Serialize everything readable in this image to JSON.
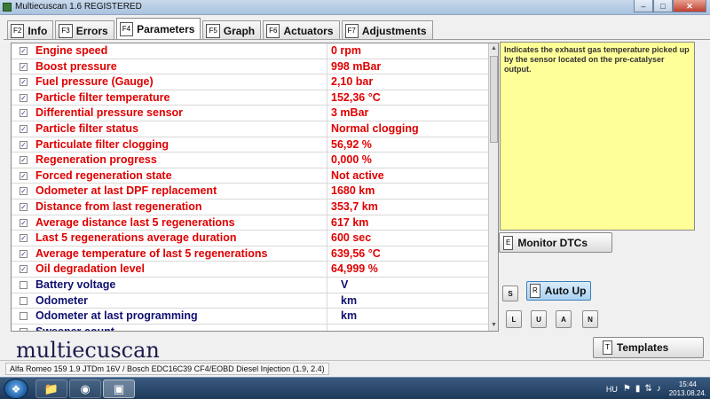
{
  "window": {
    "title": "Multiecuscan 1.6 REGISTERED"
  },
  "tabs": [
    {
      "key": "F2",
      "label": "Info"
    },
    {
      "key": "F3",
      "label": "Errors"
    },
    {
      "key": "F4",
      "label": "Parameters"
    },
    {
      "key": "F5",
      "label": "Graph"
    },
    {
      "key": "F6",
      "label": "Actuators"
    },
    {
      "key": "F7",
      "label": "Adjustments"
    }
  ],
  "active_tab": "Parameters",
  "parameters": [
    {
      "name": "Engine speed",
      "value": "0 rpm",
      "checked": true
    },
    {
      "name": "Boost pressure",
      "value": "998 mBar",
      "checked": true
    },
    {
      "name": "Fuel pressure (Gauge)",
      "value": "2,10 bar",
      "checked": true
    },
    {
      "name": "Particle filter temperature",
      "value": "152,36 °C",
      "checked": true
    },
    {
      "name": "Differential pressure sensor",
      "value": "3 mBar",
      "checked": true
    },
    {
      "name": "Particle filter status",
      "value": "Normal clogging",
      "checked": true
    },
    {
      "name": "Particulate filter clogging",
      "value": "56,92 %",
      "checked": true
    },
    {
      "name": "Regeneration progress",
      "value": "0,000 %",
      "checked": true
    },
    {
      "name": "Forced regeneration state",
      "value": "Not active",
      "checked": true
    },
    {
      "name": "Odometer at last DPF replacement",
      "value": "1680 km",
      "checked": true
    },
    {
      "name": "Distance from last regeneration",
      "value": "353,7 km",
      "checked": true
    },
    {
      "name": "Average distance last 5 regenerations",
      "value": "617 km",
      "checked": true
    },
    {
      "name": "Last 5 regenerations average duration",
      "value": "600 sec",
      "checked": true
    },
    {
      "name": "Average temperature of last 5 regenerations",
      "value": "639,56 °C",
      "checked": true
    },
    {
      "name": "Oil degradation level",
      "value": "64,999 %",
      "checked": true
    },
    {
      "name": "Battery voltage",
      "value": "V",
      "checked": false
    },
    {
      "name": "Odometer",
      "value": "km",
      "checked": false
    },
    {
      "name": "Odometer at last programming",
      "value": "km",
      "checked": false
    },
    {
      "name": "Sweeper count",
      "value": "",
      "checked": false
    }
  ],
  "description": "Indicates the exhaust gas temperature picked up by the sensor located on the pre-catalyser output.",
  "buttons": {
    "monitor_key": "E",
    "monitor_label": "Monitor DTCs",
    "s_key": "S",
    "autoup_key": "R",
    "autoup_label": "Auto Up",
    "l_key": "L",
    "u_key": "U",
    "a_key": "A",
    "n_key": "N",
    "templates_key": "T",
    "templates_label": "Templates"
  },
  "logo": "multiecuscan",
  "status": "Alfa Romeo 159 1.9 JTDm 16V / Bosch EDC16C39 CF4/EOBD Diesel Injection (1.9, 2.4)",
  "taskbar": {
    "lang": "HU",
    "time": "15:44",
    "date": "2013.08.24."
  },
  "colors": {
    "active_param": "#e00000",
    "inactive_param": "#101070",
    "description_bg": "#ffff99",
    "autoup_bg": "#a9d2f2"
  },
  "icons": {
    "checkbox": "checkmark",
    "tray": [
      "flag-icon",
      "battery-icon",
      "network-icon",
      "volume-icon"
    ]
  }
}
